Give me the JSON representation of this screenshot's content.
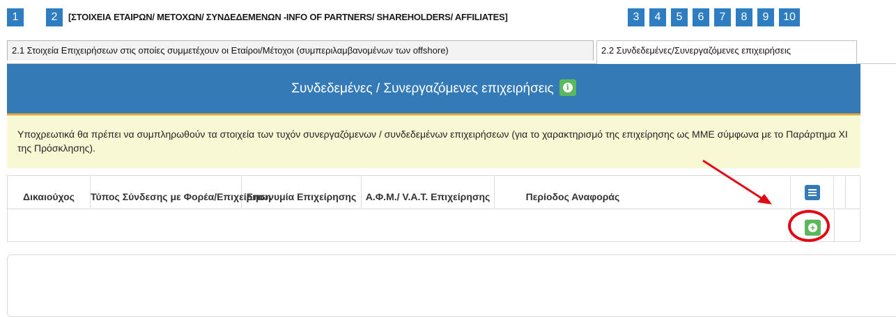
{
  "steps": {
    "items": [
      "1",
      "2",
      "3",
      "4",
      "5",
      "6",
      "7",
      "8",
      "9",
      "10"
    ],
    "active_title": "[ΣΤΟΙΧΕΙΑ ΕΤΑΙΡΩΝ/ ΜΕΤΟΧΩΝ/ ΣΥΝΔΕΔΕΜΕΝΩΝ -INFO OF PARTNERS/ SHAREHOLDERS/ AFFILIATES]"
  },
  "subtabs": [
    {
      "label": "2.1 Στοιχεία Επιχειρήσεων στις οποίες συμμετέχουν οι Εταίροι/Μέτοχοι (συμπεριλαμβανομένων των offshore)"
    },
    {
      "label": "2.2 Συνδεδεμένες/Συνεργαζόμενες επιχειρήσεις"
    }
  ],
  "panel": {
    "title": "Συνδεδεμένες / Συνεργαζόμενες επιχειρήσεις",
    "info_icon": "i",
    "notice": "Υποχρεωτικά θα πρέπει να συμπληρωθούν τα στοιχεία των τυχόν συνεργαζόμενων / συνδεδεμένων επιχειρήσεων (για το χαρακτηρισμό της επιχείρησης ως ΜΜΕ σύμφωνα με το Παράρτημα ΧΙ της Πρόσκλησης)."
  },
  "table": {
    "columns": [
      "Δικαιούχος",
      "Τύπος Σύνδεσης με Φορέα/Επιχείρηση",
      "Επωνυμία Επιχείρησης",
      "Α.Φ.Μ./ V.A.T. Επιχείρησης",
      "Περίοδος Αναφοράς"
    ],
    "rows": [],
    "add_icon": "+",
    "list_icon": "list-icon"
  },
  "colors": {
    "primary": "#337ab7",
    "success": "#5cb85c",
    "notice_bg": "#f8f8d4",
    "annotation_red": "#e30613",
    "header_underline": "#e8a33a"
  }
}
